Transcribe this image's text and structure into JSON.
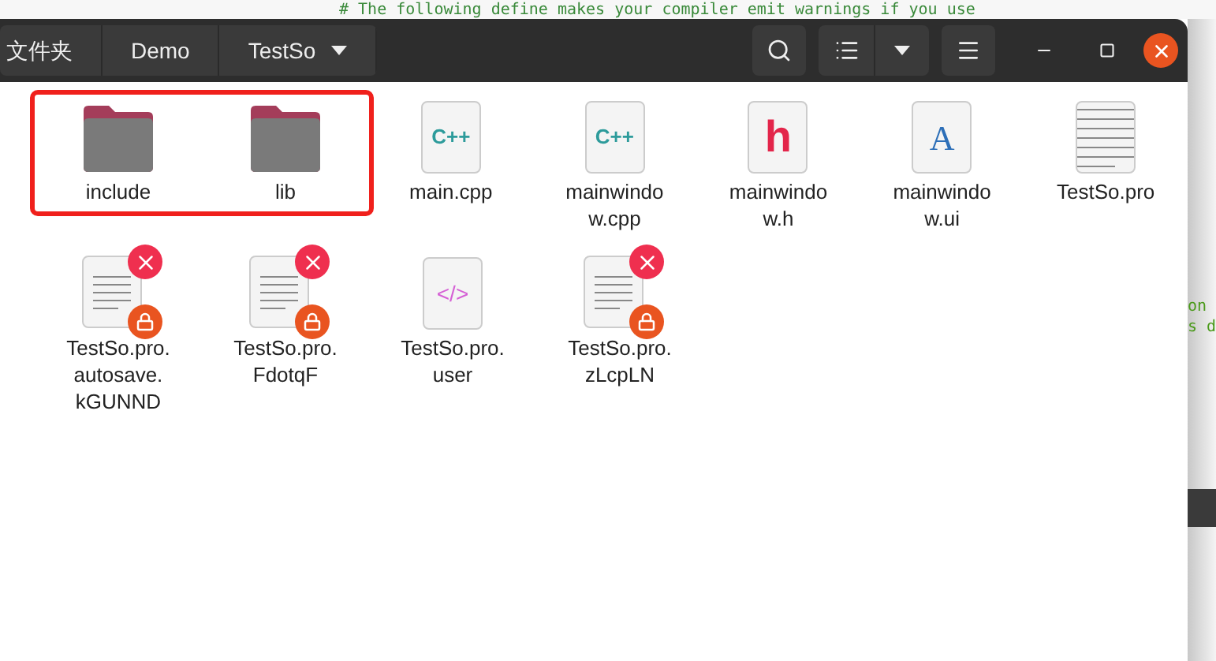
{
  "background_editor": {
    "line": "# The following define makes your compiler emit warnings if you use",
    "fragments": [
      "on",
      "s d"
    ]
  },
  "header": {
    "path": [
      {
        "label": "文件夹",
        "dropdown": false
      },
      {
        "label": "Demo",
        "dropdown": false
      },
      {
        "label": "TestSo",
        "dropdown": true
      }
    ]
  },
  "files": [
    {
      "kind": "folder",
      "lines": [
        "include"
      ],
      "highlighted": true
    },
    {
      "kind": "folder",
      "lines": [
        "lib"
      ],
      "highlighted": true
    },
    {
      "kind": "cpp",
      "lines": [
        "main.cpp"
      ],
      "highlighted": false,
      "glyph": "C++"
    },
    {
      "kind": "cpp",
      "lines": [
        "mainwindo",
        "w.cpp"
      ],
      "highlighted": false,
      "glyph": "C++"
    },
    {
      "kind": "header",
      "lines": [
        "mainwindo",
        "w.h"
      ],
      "highlighted": false,
      "glyph": "h"
    },
    {
      "kind": "ui",
      "lines": [
        "mainwindo",
        "w.ui"
      ],
      "highlighted": false,
      "glyph": "A"
    },
    {
      "kind": "text",
      "lines": [
        "TestSo.pro"
      ],
      "highlighted": false
    },
    {
      "kind": "locked",
      "lines": [
        "TestSo.pro.",
        "autosave.",
        "kGUNND"
      ],
      "highlighted": false
    },
    {
      "kind": "locked",
      "lines": [
        "TestSo.pro.",
        "FdotqF"
      ],
      "highlighted": false
    },
    {
      "kind": "code",
      "lines": [
        "TestSo.pro.",
        "user"
      ],
      "highlighted": false,
      "glyph": "</>"
    },
    {
      "kind": "locked",
      "lines": [
        "TestSo.pro.",
        "zLcpLN"
      ],
      "highlighted": false
    }
  ]
}
